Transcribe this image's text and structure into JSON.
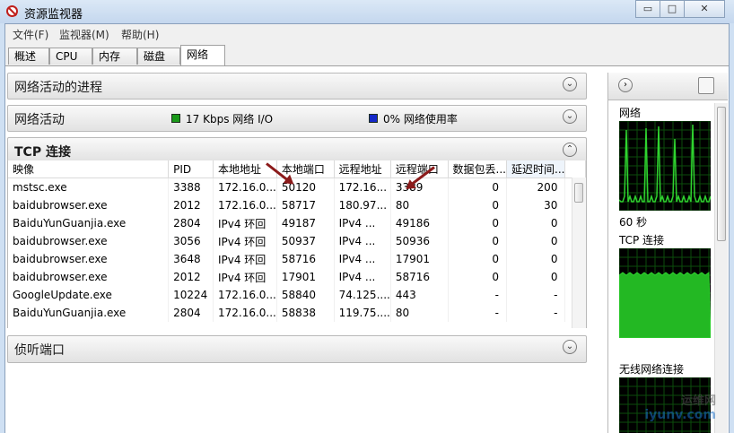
{
  "window": {
    "title": "资源监视器",
    "minimize_glyph": "▭",
    "maximize_glyph": "□",
    "close_glyph": "✕"
  },
  "menu": {
    "items": [
      "文件(F)",
      "监视器(M)",
      "帮助(H)"
    ]
  },
  "tabs": [
    {
      "label": "概述"
    },
    {
      "label": "CPU"
    },
    {
      "label": "内存"
    },
    {
      "label": "磁盘"
    },
    {
      "label": "网络",
      "active": true
    }
  ],
  "sections": {
    "processes": {
      "title": "网络活动的进程"
    },
    "activity": {
      "title": "网络活动",
      "io_text": "17 Kbps 网络 I/O",
      "usage_text": "0% 网络使用率",
      "io_color": "#1a9a1a",
      "usage_color": "#1428c8"
    },
    "tcp": {
      "title": "TCP 连接"
    },
    "listening": {
      "title": "侦听端口"
    }
  },
  "tcp_table": {
    "columns": [
      "映像",
      "PID",
      "本地地址",
      "本地端口",
      "远程地址",
      "远程端口",
      "数据包丢...",
      "延迟时间..."
    ],
    "rows": [
      [
        "mstsc.exe",
        "3388",
        "172.16.0...",
        "50120",
        "172.16...",
        "3389",
        "0",
        "200"
      ],
      [
        "baidubrowser.exe",
        "2012",
        "172.16.0...",
        "58717",
        "180.97...",
        "80",
        "0",
        "30"
      ],
      [
        "BaiduYunGuanjia.exe",
        "2804",
        "IPv4 环回",
        "49187",
        "IPv4 ...",
        "49186",
        "0",
        "0"
      ],
      [
        "baidubrowser.exe",
        "3056",
        "IPv4 环回",
        "50937",
        "IPv4 ...",
        "50936",
        "0",
        "0"
      ],
      [
        "baidubrowser.exe",
        "3648",
        "IPv4 环回",
        "58716",
        "IPv4 ...",
        "17901",
        "0",
        "0"
      ],
      [
        "baidubrowser.exe",
        "2012",
        "IPv4 环回",
        "17901",
        "IPv4 ...",
        "58716",
        "0",
        "0"
      ],
      [
        "GoogleUpdate.exe",
        "10224",
        "172.16.0...",
        "58840",
        "74.125....",
        "443",
        "-",
        "-"
      ],
      [
        "BaiduYunGuanjia.exe",
        "2804",
        "172.16.0...",
        "58838",
        "119.75....",
        "80",
        "-",
        "-"
      ]
    ]
  },
  "right_panel": {
    "graphs": [
      {
        "label": "网络",
        "footer": "60 秒",
        "color": "#2fd32f"
      },
      {
        "label": "TCP 连接",
        "color": "#2fd32f"
      },
      {
        "label": "无线网络连接",
        "color": "#2fd32f"
      }
    ]
  },
  "watermark": {
    "line1": "运维网",
    "line2": "iyunv.com"
  }
}
